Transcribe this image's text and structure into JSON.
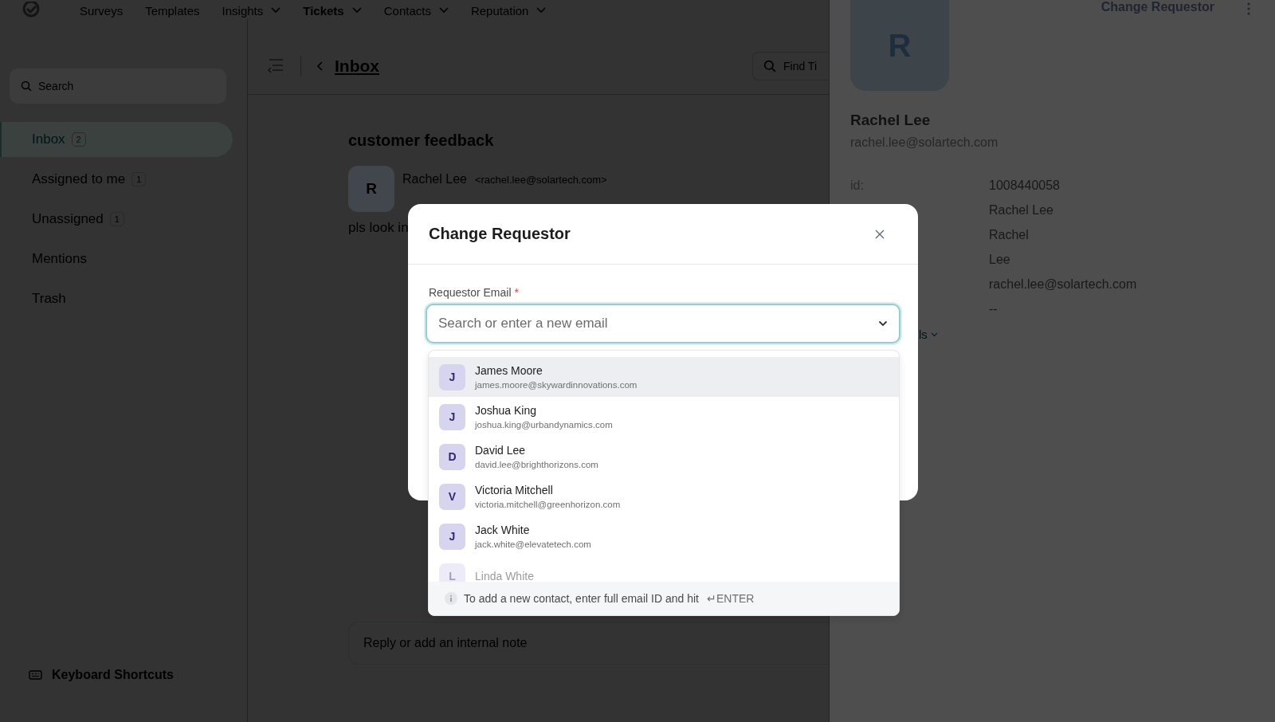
{
  "nav": {
    "items": [
      {
        "label": "Surveys",
        "dropdown": false,
        "selected": false
      },
      {
        "label": "Templates",
        "dropdown": false,
        "selected": false
      },
      {
        "label": "Insights",
        "dropdown": true,
        "selected": false
      },
      {
        "label": "Tickets",
        "dropdown": true,
        "selected": true
      },
      {
        "label": "Contacts",
        "dropdown": true,
        "selected": false
      },
      {
        "label": "Reputation",
        "dropdown": true,
        "selected": false
      }
    ]
  },
  "sidebar": {
    "search_placeholder": "Search",
    "items": [
      {
        "label": "Inbox",
        "count": "2",
        "selected": true
      },
      {
        "label": "Assigned to me",
        "count": "1",
        "selected": false
      },
      {
        "label": "Unassigned",
        "count": "1",
        "selected": false
      },
      {
        "label": "Mentions",
        "selected": false
      },
      {
        "label": "Trash",
        "selected": false
      }
    ],
    "shortcuts": "Keyboard Shortcuts"
  },
  "main": {
    "back": "Inbox",
    "find_placeholder": "Find Ti",
    "ticket_title": "customer feedback",
    "sender_initial": "R",
    "sender_name": "Rachel Lee",
    "sender_email": "<rachel.lee@solartech.com>",
    "body": "pls look in",
    "reply_placeholder": "Reply or add an internal note"
  },
  "drawer": {
    "action": "Change Requestor",
    "initial": "R",
    "name": "Rachel Lee",
    "email": "rachel.lee@solartech.com",
    "fields": [
      {
        "label": "id:",
        "value": "1008440058"
      },
      {
        "value": "Rachel Lee"
      },
      {
        "value": "Rachel"
      },
      {
        "value": "Lee"
      },
      {
        "value": "rachel.lee@solartech.com"
      },
      {
        "value": "--"
      }
    ],
    "details_link": "ls"
  },
  "modal": {
    "title": "Change Requestor",
    "field_label": "Requestor Email",
    "required_mark": "*",
    "placeholder": "Search or enter a new email",
    "options": [
      {
        "initial": "J",
        "name": "James Moore",
        "email": "james.moore@skywardinnovations.com",
        "selected": true
      },
      {
        "initial": "J",
        "name": "Joshua King",
        "email": "joshua.king@urbandynamics.com",
        "selected": false
      },
      {
        "initial": "D",
        "name": "David Lee",
        "email": "david.lee@brighthorizons.com",
        "selected": false
      },
      {
        "initial": "V",
        "name": "Victoria Mitchell",
        "email": "victoria.mitchell@greenhorizon.com",
        "selected": false
      },
      {
        "initial": "J",
        "name": "Jack White",
        "email": "jack.white@elevatetech.com",
        "selected": false
      },
      {
        "initial": "L",
        "name": "Linda White",
        "selected": false
      }
    ],
    "hint": "To add a new contact, enter full email ID and hit",
    "hint_key": "↵ENTER"
  }
}
